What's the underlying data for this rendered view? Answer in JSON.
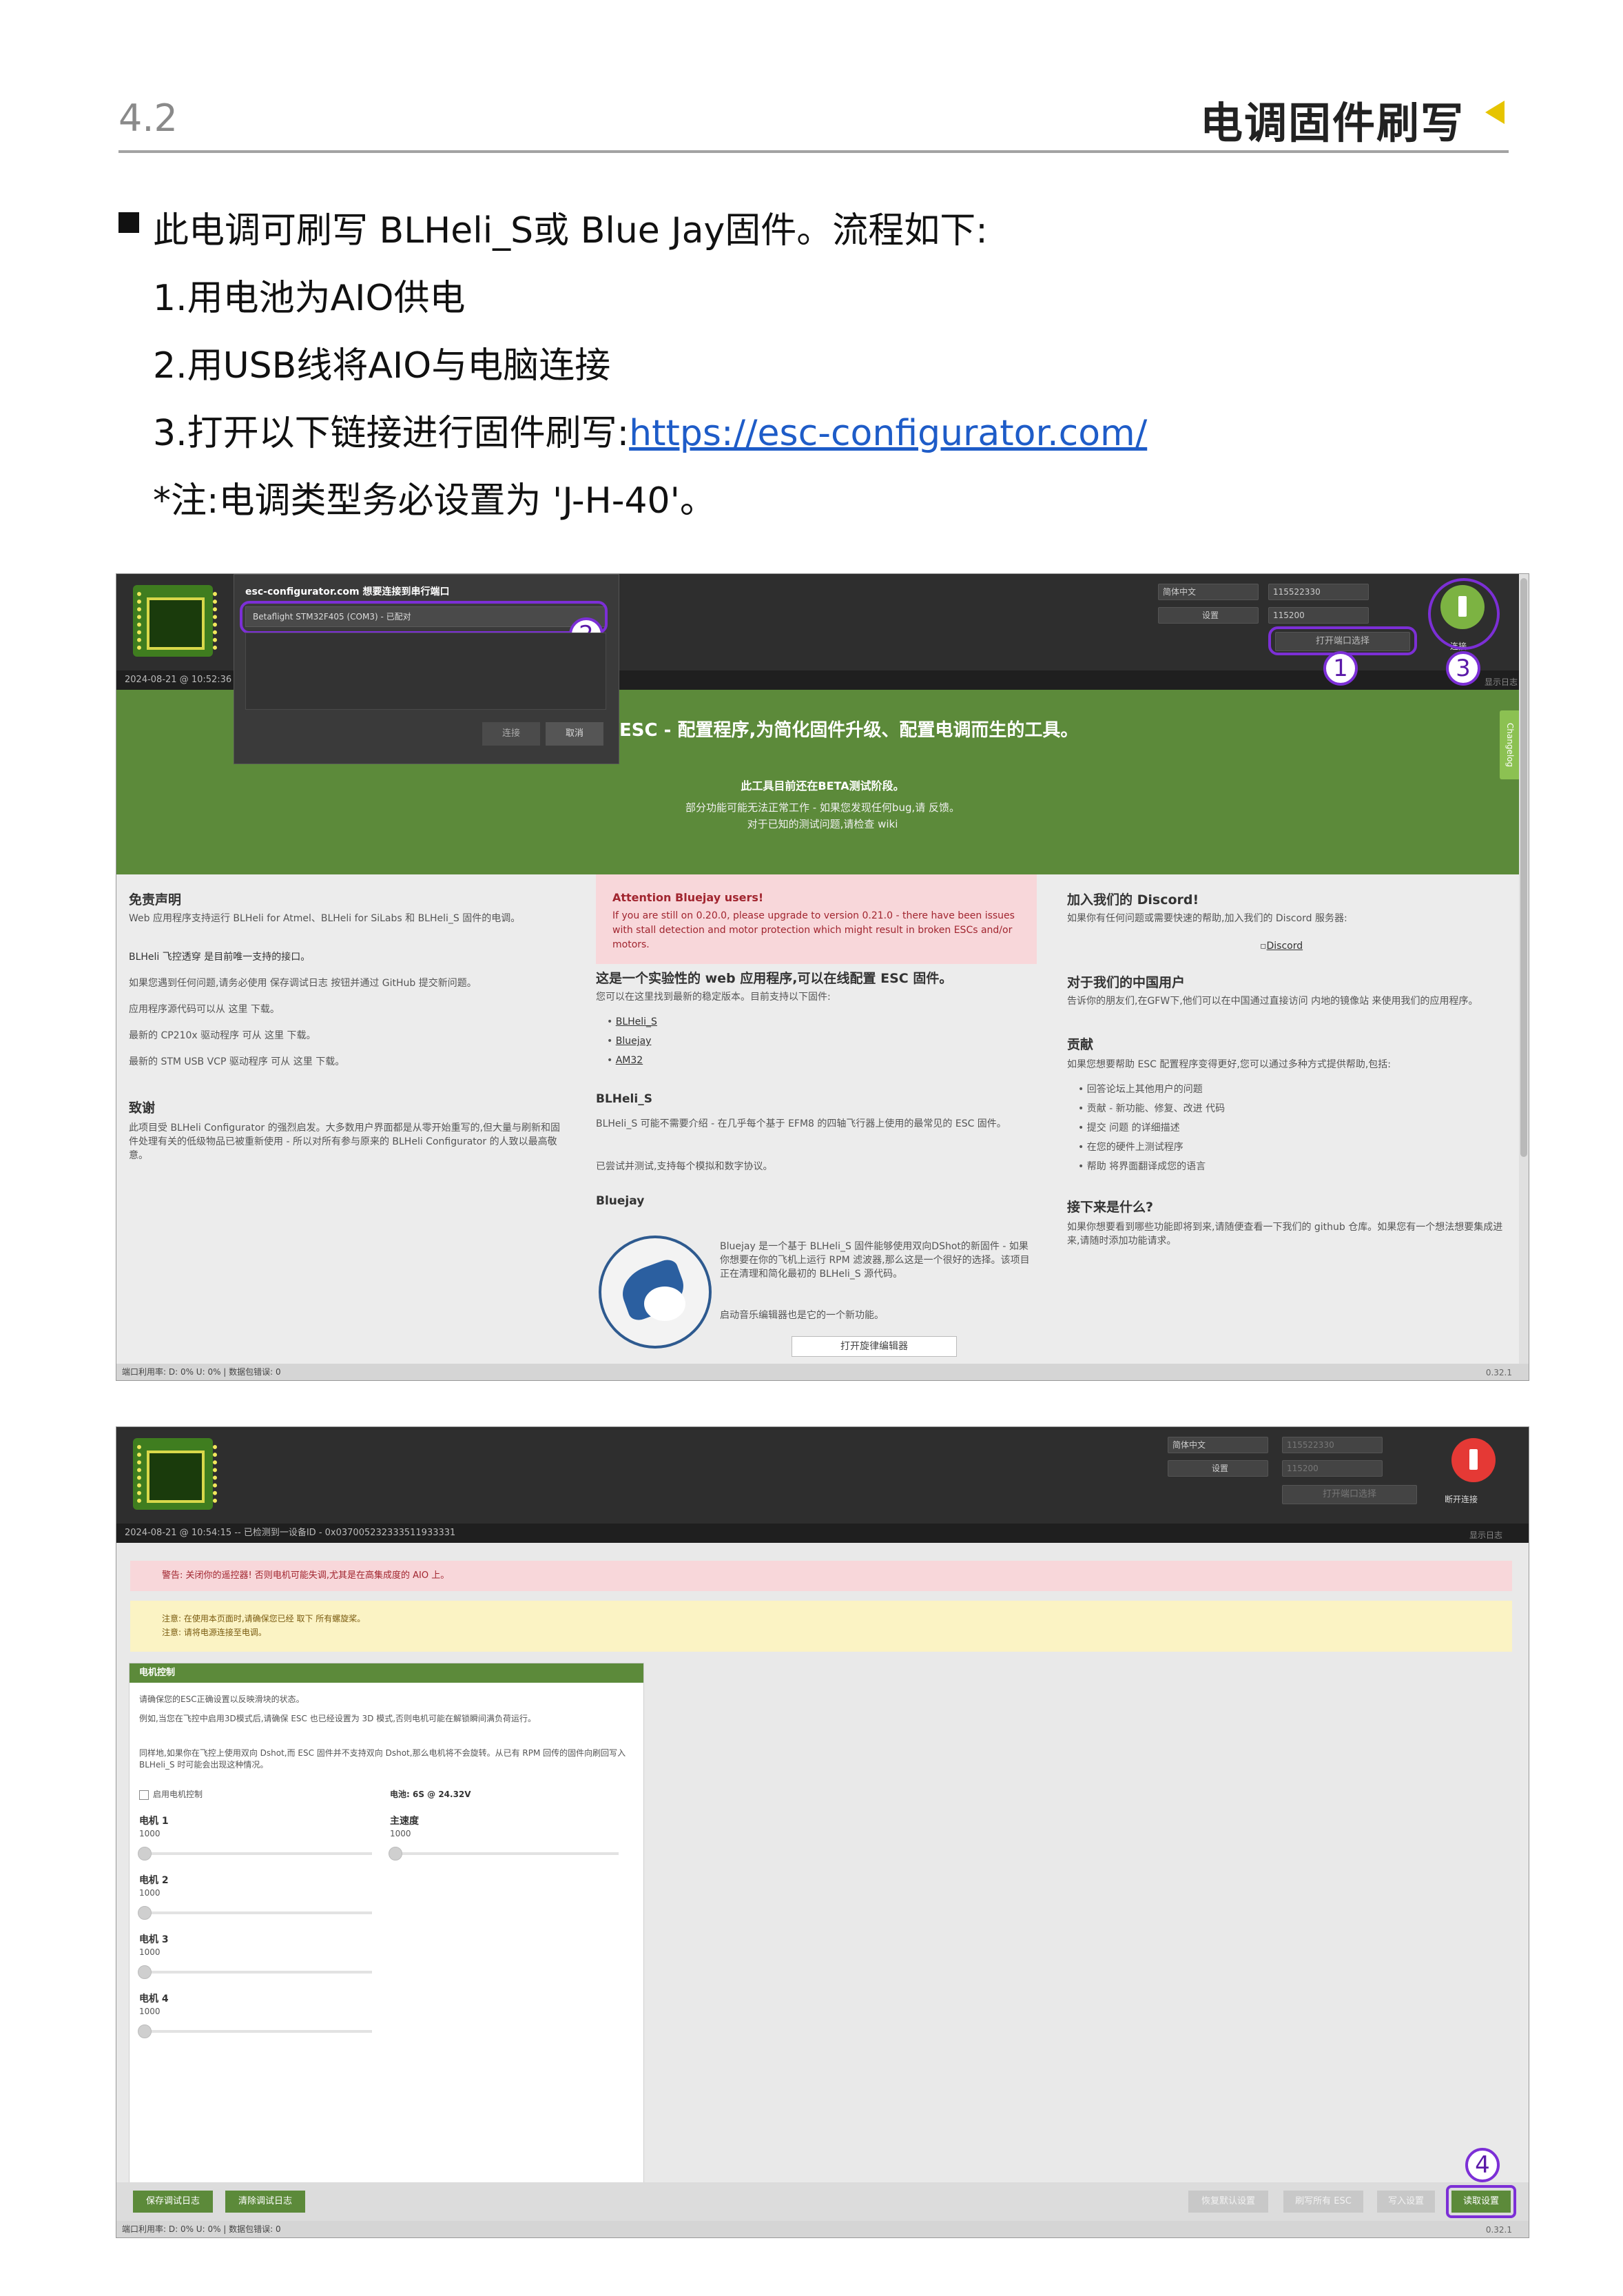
{
  "header": {
    "section_number": "4.2",
    "section_title": "电调固件刷写"
  },
  "instructions": {
    "intro": "此电调可刷写 BLHeli_S或 Blue Jay固件。流程如下:",
    "step1": "1.用电池为AIO供电",
    "step2": "2.用USB线将AIO与电脑连接",
    "step3_prefix": "3.打开以下链接进行固件刷写:",
    "step3_link": "https://esc-configurator.com/",
    "note": "*注:电调类型务必设置为 'J-H-40'。"
  },
  "shot1": {
    "modal": {
      "title": "esc-configurator.com 想要连接到串行端口",
      "port": "Betaflight STM32F405 (COM3) - 已配对",
      "connect": "连接",
      "cancel": "取消"
    },
    "timestamp": "2024-08-21 @ 10:52:36",
    "language": "简体中文",
    "baud": "115522330",
    "settings": "设置",
    "rate": "115200",
    "open_port": "打开端口选择",
    "connect_label": "连接",
    "show_log": "显示日志",
    "marks": [
      "1",
      "2",
      "3"
    ],
    "banner": {
      "title": "ESC - 配置程序,为简化固件升级、配置电调而生的工具。",
      "beta": "此工具目前还在BETA测试阶段。",
      "line1": "部分功能可能无法正常工作 - 如果您发现任何bug,请 反馈。",
      "line2": "对于已知的测试问题,请检查 wiki",
      "changelog": "Changelog"
    },
    "left": {
      "disclaimer_h": "免责声明",
      "disclaimer_t": "Web 应用程序支持运行 BLHeli for Atmel、BLHeli for SiLabs 和 BLHeli_S 固件的电调。",
      "fc_passthrough": "BLHeli 飞控透穿 是目前唯一支持的接口。",
      "issues": "如果您遇到任何问题,请务必使用 保存调试日志 按钮并通过 GitHub 提交新问题。",
      "source": "应用程序源代码可以从 这里 下载。",
      "cp210x": "最新的 CP210x 驱动程序 可从 这里 下载。",
      "stm": "最新的 STM USB VCP 驱动程序 可从 这里 下载。",
      "thanks_h": "致谢",
      "thanks_t": "此项目受 BLHeli Configurator 的强烈启发。大多数用户界面都是从零开始重写的,但大量与刷新和固件处理有关的低级物品已被重新使用 - 所以对所有参与原来的 BLHeli Configurator 的人致以最高敬意。"
    },
    "middle": {
      "alert_h": "Attention Bluejay users!",
      "alert_t": "If you are still on 0.20.0, please upgrade to version 0.21.0 - there have been issues with stall detection and motor protection which might result in broken ESCs and/or motors.",
      "exp_h": "这是一个实验性的 web 应用程序,可以在线配置 ESC 固件。",
      "exp_t": "您可以在这里找到最新的稳定版本。目前支持以下固件:",
      "fw_list": [
        "BLHeli_S",
        "Bluejay",
        "AM32"
      ],
      "blheli_h": "BLHeli_S",
      "blheli_t": "BLHeli_S 可能不需要介绍 - 在几乎每个基于 EFM8 的四轴飞行器上使用的最常见的 ESC 固件。",
      "blheli_t2": "已尝试并测试,支持每个模拟和数字协议。",
      "bluejay_h": "Bluejay",
      "bluejay_t": "Bluejay 是一个基于 BLHeli_S 固件能够使用双向DShot的新固件 - 如果你想要在你的飞机上运行 RPM 滤波器,那么这是一个很好的选择。该项目正在清理和简化最初的 BLHeli_S 源代码。",
      "bluejay_t2": "启动音乐编辑器也是它的一个新功能。",
      "open_editor": "打开旋律编辑器"
    },
    "right": {
      "discord_h": "加入我们的 Discord!",
      "discord_t": "如果你有任何问题或需要快速的帮助,加入我们的 Discord 服务器:",
      "discord_img": "Discord",
      "china_h": "对于我们的中国用户",
      "china_t": "告诉你的朋友们,在GFW下,他们可以在中国通过直接访问 内地的镜像站 来使用我们的应用程序。",
      "contrib_h": "贡献",
      "contrib_t": "如果您想要帮助 ESC 配置程序变得更好,您可以通过多种方式提供帮助,包括:",
      "contrib_list": [
        "回答论坛上其他用户的问题",
        "贡献 - 新功能、修复、改进 代码",
        "提交 问题 的详细描述",
        "在您的硬件上测试程序",
        "帮助 将界面翻译成您的语言"
      ],
      "next_h": "接下来是什么?",
      "next_t": "如果你想要看到哪些功能即将到来,请随便查看一下我们的 github 仓库。如果您有一个想法想要集成进来,请随时添加功能请求。"
    },
    "status": "端口利用率: D: 0% U: 0%  |  数据包错误: 0",
    "version": "0.32.1"
  },
  "shot2": {
    "language": "简体中文",
    "baud": "115522330",
    "settings": "设置",
    "rate": "115200",
    "open_port": "打开端口选择",
    "disconnect": "断开连接",
    "show_log": "显示日志",
    "timestamp": "2024-08-21 @ 10:54:15 -- 已检测到一设备ID - 0x037005232333511933331",
    "warn_red": "警告: 关闭你的遥控器! 否则电机可能失调,尤其是在高集成度的 AIO 上。",
    "warn_yel_1": "注意: 在使用本页面时,请确保您已经 取下 所有螺旋桨。",
    "warn_yel_2": "注意: 请将电源连接至电调。",
    "panel": {
      "title": "电机控制",
      "t1": "请确保您的ESC正确设置以反映滑块的状态。",
      "t2": "例如,当您在飞控中启用3D模式后,请确保 ESC 也已经设置为 3D 模式,否则电机可能在解锁瞬间满负荷运行。",
      "t3": "同样地,如果你在飞控上使用双向 Dshot,而 ESC 固件并不支持双向 Dshot,那么电机将不会旋转。从已有 RPM 回传的固件向刷回写入 BLHeli_S 时可能会出现这种情况。",
      "enable": "启用电机控制",
      "battery": "电池: 6S @ 24.32V",
      "master": "主速度",
      "master_val": "1000",
      "motors": [
        {
          "name": "电机 1",
          "value": "1000"
        },
        {
          "name": "电机 2",
          "value": "1000"
        },
        {
          "name": "电机 3",
          "value": "1000"
        },
        {
          "name": "电机 4",
          "value": "1000"
        }
      ]
    },
    "btn_save_log": "保存调试日志",
    "btn_clear_log": "清除调试日志",
    "btn_defaults": "恢复默认设置",
    "btn_flash_all": "刷写所有 ESC",
    "btn_import": "写入设置",
    "btn_read": "读取设置",
    "mark": "4",
    "status": "端口利用率: D: 0% U: 0%  |  数据包错误: 0",
    "version": "0.32.1"
  }
}
